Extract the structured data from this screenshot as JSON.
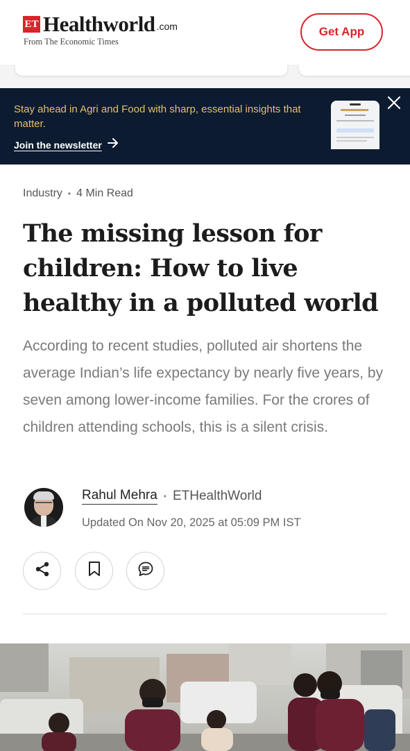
{
  "header": {
    "logo_et": "ET",
    "brand": "Healthworld",
    "brand_suffix": ".com",
    "tagline": "From The Economic Times",
    "get_app_label": "Get App",
    "brand_color": "#d7252b"
  },
  "newsletter_banner": {
    "text": "Stay ahead in Agri and Food with sharp, essential insights that matter.",
    "link_label": "Join the newsletter",
    "link_icon": "arrow-right-icon",
    "close_icon": "close-icon",
    "background": "#0c1b30",
    "text_color": "#e7bf68"
  },
  "article": {
    "category": "Industry",
    "read_time": "4 Min Read",
    "title": "The missing lesson for children: How to live healthy in a polluted world",
    "summary": "According to recent studies, polluted air shortens the average Indian’s life expectancy by nearly five years, by seven among lower-income families. For the crores of children attending schools, this is a silent crisis.",
    "author": {
      "name": "Rahul Mehra",
      "publication": "ETHealthWorld",
      "updated": "Updated On Nov 20, 2025 at 05:09 PM IST"
    },
    "actions": [
      {
        "name": "share",
        "icon": "share-icon"
      },
      {
        "name": "bookmark",
        "icon": "bookmark-icon"
      },
      {
        "name": "comment",
        "icon": "comment-icon"
      }
    ]
  }
}
